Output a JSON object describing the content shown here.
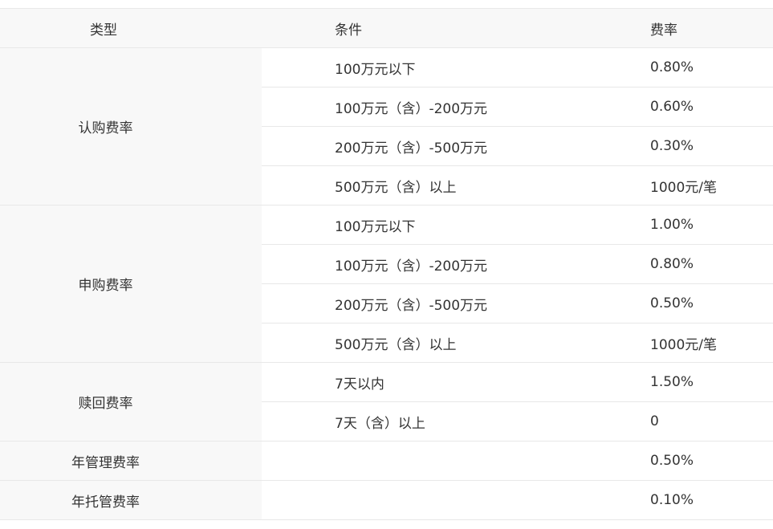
{
  "headers": {
    "type": "类型",
    "condition": "条件",
    "rate": "费率"
  },
  "groups": [
    {
      "type": "认购费率",
      "rows": [
        {
          "condition": "100万元以下",
          "rate": "0.80%"
        },
        {
          "condition": "100万元（含）-200万元",
          "rate": "0.60%"
        },
        {
          "condition": "200万元（含）-500万元",
          "rate": "0.30%"
        },
        {
          "condition": "500万元（含）以上",
          "rate": "1000元/笔"
        }
      ]
    },
    {
      "type": "申购费率",
      "rows": [
        {
          "condition": "100万元以下",
          "rate": "1.00%"
        },
        {
          "condition": "100万元（含）-200万元",
          "rate": "0.80%"
        },
        {
          "condition": "200万元（含）-500万元",
          "rate": "0.50%"
        },
        {
          "condition": "500万元（含）以上",
          "rate": "1000元/笔"
        }
      ]
    },
    {
      "type": "赎回费率",
      "rows": [
        {
          "condition": "7天以内",
          "rate": "1.50%"
        },
        {
          "condition": "7天（含）以上",
          "rate": "0"
        }
      ]
    },
    {
      "type": "年管理费率",
      "rows": [
        {
          "condition": "",
          "rate": "0.50%"
        }
      ]
    },
    {
      "type": "年托管费率",
      "rows": [
        {
          "condition": "",
          "rate": "0.10%"
        }
      ]
    }
  ]
}
